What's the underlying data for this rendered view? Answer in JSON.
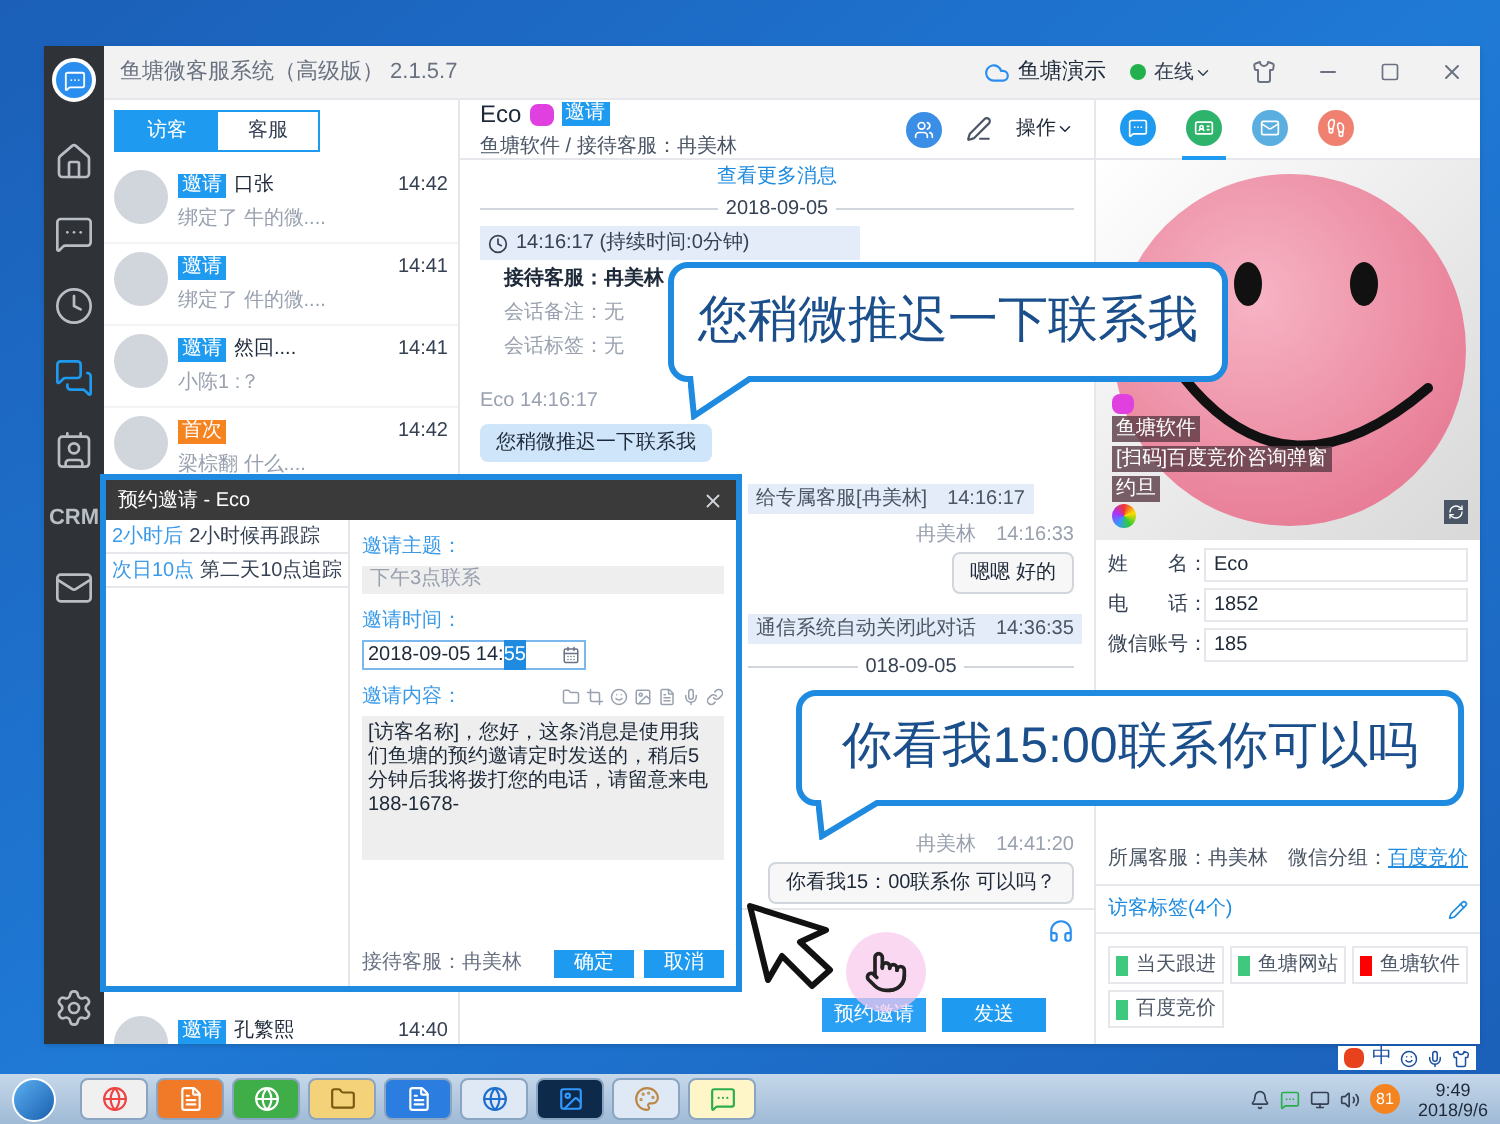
{
  "window": {
    "title": "鱼塘微客服系统（高级版） 2.1.5.7",
    "account": "鱼塘演示",
    "status": "在线"
  },
  "rail": [
    {
      "kind": "home",
      "selected": false
    },
    {
      "kind": "chat",
      "selected": false
    },
    {
      "kind": "history",
      "selected": false
    },
    {
      "kind": "chats",
      "selected": true
    },
    {
      "kind": "contacts",
      "selected": false
    },
    {
      "kind": "crm",
      "label": "CRM",
      "selected": false
    },
    {
      "kind": "mail",
      "selected": false
    }
  ],
  "list_tabs": [
    {
      "label": "访客",
      "selected": true
    },
    {
      "label": "客服",
      "selected": false
    }
  ],
  "conversations": [
    {
      "kind": "invite",
      "badge": "邀请",
      "name": "口张",
      "preview": "绑定了 牛的微....",
      "time": "14:42"
    },
    {
      "kind": "invite",
      "badge": "邀请",
      "preview": "绑定了 件的微....",
      "time": "14:41"
    },
    {
      "kind": "invite",
      "badge": "邀请",
      "name": "然回....",
      "preview": "小陈1 :？",
      "time": "14:41"
    },
    {
      "kind": "first",
      "badge": "首次",
      "preview": "梁棕翻 什么....",
      "time": "14:42"
    },
    {
      "kind": "invite",
      "badge": "邀请",
      "name": "孔繁熙",
      "time": "14:40"
    }
  ],
  "chat": {
    "name": "Eco",
    "badge": "邀请",
    "subtitle": "鱼塘软件 / 接待客服：冉美林",
    "menu": "操作",
    "more_link": "查看更多消息",
    "messages": [
      {
        "kind": "date",
        "text": "2018-09-05"
      },
      {
        "kind": "session",
        "header": "14:16:17 (持续时间:0分钟)",
        "agent": "接待客服：冉美林",
        "lines": [
          "会话备注：无",
          "会话标签：无"
        ]
      },
      {
        "kind": "incoming",
        "sender": "Eco",
        "time": "14:16:17",
        "text": "您稍微推迟一下联系我"
      },
      {
        "kind": "system",
        "text": "给专属客服[冉美林]",
        "time": "14:16:17"
      },
      {
        "kind": "outgoing",
        "sender": "冉美林",
        "time": "14:16:33",
        "text": "嗯嗯 好的"
      },
      {
        "kind": "system",
        "text": "通信系统自动关闭此对话",
        "time": "14:36:35"
      },
      {
        "kind": "date",
        "text": "018-09-05"
      },
      {
        "kind": "outgoing",
        "sender": "冉美林",
        "time": "14:41:20",
        "text": "你看我15：00联系你 可以吗？"
      }
    ],
    "buttons": [
      {
        "kind": "schedule",
        "label": "预约邀请"
      },
      {
        "kind": "send",
        "label": "发送"
      }
    ]
  },
  "profile": {
    "tabs": [
      {
        "kind": "chat",
        "selected": false
      },
      {
        "kind": "card",
        "selected": true
      },
      {
        "kind": "mail",
        "selected": false
      },
      {
        "kind": "footprint",
        "selected": false
      }
    ],
    "picture_lines": [
      "鱼塘软件",
      "[扫码]百度竞价咨询弹窗",
      "约旦"
    ],
    "fields": [
      {
        "label": "姓　　名：",
        "value": "Eco"
      },
      {
        "label": "电　　话：",
        "value": "1852"
      },
      {
        "label": "微信账号：",
        "value": "185"
      }
    ],
    "owner": "所属客服：冉美林",
    "group_label": "微信分组：",
    "group_link": "百度竞价",
    "tags_title": "访客标签(4个)",
    "tags": [
      {
        "label": "当天跟进",
        "color": "#3ec97f"
      },
      {
        "label": "鱼塘网站",
        "color": "#3ec97f"
      },
      {
        "label": "鱼塘软件",
        "color": "#ff0000"
      },
      {
        "label": "百度竞价",
        "color": "#3ec97f"
      }
    ]
  },
  "dialog": {
    "title": "预约邀请 - Eco",
    "presets": [
      {
        "tag": "2小时后",
        "text": "2小时候再跟踪"
      },
      {
        "tag": "次日10点",
        "text": "第二天10点追踪"
      }
    ],
    "subject_label": "邀请主题：",
    "subject": "下午3点联系",
    "time_label": "邀请时间：",
    "time_value": "2018-09-05 14:",
    "time_selection": "55",
    "content_label": "邀请内容：",
    "content": "[访客名称]，您好，这条消息是使用我们鱼塘的预约邀请定时发送的，稍后5分钟后我将拨打您的电话，请留意来电188-1678-",
    "agent": "接待客服：冉美林",
    "buttons": [
      "确定",
      "取消"
    ]
  },
  "callouts": [
    "您稍微推迟一下联系我",
    "你看我15:00联系你可以吗"
  ],
  "taskbar": {
    "ime": "中",
    "badge": "81",
    "time": "9:49",
    "date": "2018/9/6"
  }
}
